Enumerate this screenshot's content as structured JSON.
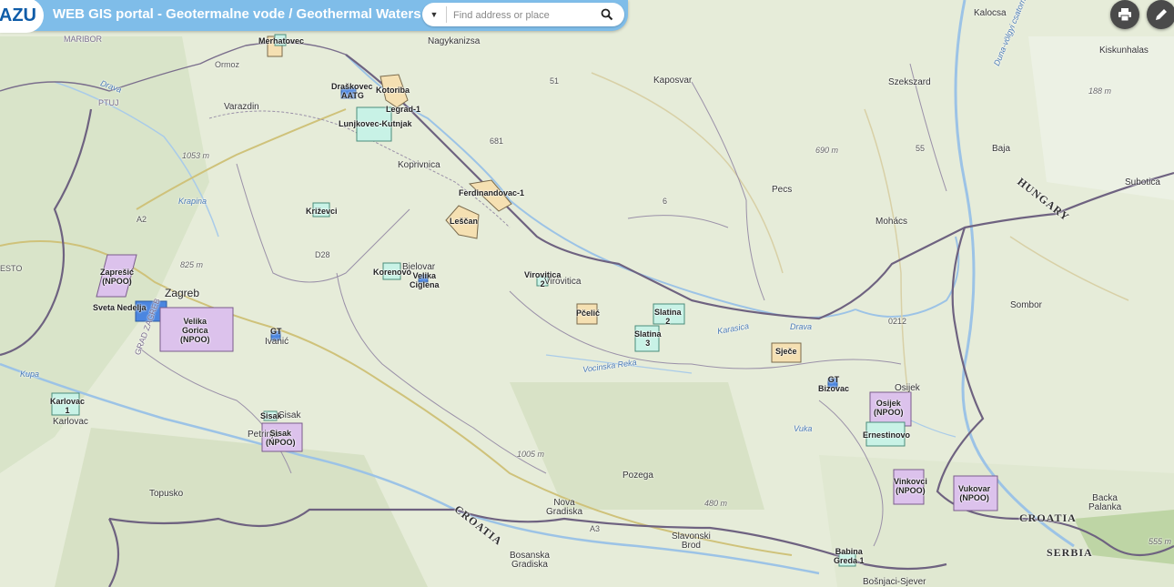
{
  "header": {
    "logo": "AZU",
    "title": "WEB GIS portal - Geotermalne vode / Geothermal Waters"
  },
  "search": {
    "placeholder": "Find address or place"
  },
  "toolbar": {
    "print_icon": "printer-icon",
    "edit_icon": "pencil-icon"
  },
  "map": {
    "cities": {
      "kalocsa": "Kalocsa",
      "kiskunhalas": "Kiskunhalas",
      "nagykanizsa": "Nagykanizsa",
      "kaposvar": "Kaposvar",
      "szekszard": "Szekszard",
      "ormoz": "Ormoz",
      "varazdin": "Varazdin",
      "baja": "Baja",
      "koprivnica": "Koprivnica",
      "pecs": "Pecs",
      "subotica": "Subotica",
      "mohacs": "Mohács",
      "zagreb": "Zagreb",
      "bjelovar": "Bjelovar",
      "virovitica": "Virovitica",
      "sombor": "Sombor",
      "ivanic": "Ivanić",
      "osijek": "Osijek",
      "karlovac": "Karlovac",
      "sisak": "Sisak",
      "petrinja": "Petrinja",
      "topusko": "Topusko",
      "pozega": "Pozega",
      "nova_gradiska": "Nova\nGradiska",
      "slavonski_brod": "Slavonski\nBrod",
      "bosanska_gradiska": "Bosanska\nGradiska",
      "backa_palanka": "Backa\nPalanka",
      "bosnjaci": "Bošnjaci-Sjever",
      "maribor": "MARIBOR",
      "pito": "PTUJ"
    },
    "sites": {
      "merhatovec": "Merhatovec",
      "draskovec": "Draškovec",
      "aatg": "AATG",
      "kotoriba": "Kotoriba",
      "legrad": "Legrad-1",
      "lunjkovec": "Lunjkovec-Kutnjak",
      "ferdinandovac": "Ferdinandovac-1",
      "krizevci": "Križevci",
      "lescan": "Leščan",
      "zapresic": "Zaprešić\n(NPOO)",
      "korenovo": "Korenovo",
      "velika_ciglena": "Velika\nCiglena",
      "virovitica2": "Virovitica\n2",
      "sveta_nedelja": "Sveta Nedelja",
      "velika_gorica": "Velika\nGorica\n(NPOO)",
      "pcelic": "Pčelić",
      "slatina2": "Slatina\n2",
      "slatina3": "Slatina\n3",
      "gt_ivanic": "GT",
      "sjece": "Sječe",
      "gt_bizovac": "GT\nBizovac",
      "osijek_npoo": "Osijek\n(NPOO)",
      "karlovac1": "Karlovac\n1",
      "sisak_npoo": "Sisak\n(NPOO)",
      "sisak_small": "Sisak",
      "ernestinovo": "Ernestinovo",
      "vinkovci": "Vinkovci\n(NPOO)",
      "vukovar": "Vukovar\n(NPOO)",
      "babina_greda": "Babina\nGreda 1"
    },
    "rivers": {
      "drava1": "Drava",
      "drava2": "Drava",
      "krapina": "Krapina",
      "karasica": "Karasica",
      "vocinska": "Vocinska Reka",
      "vuka": "Vuka",
      "duna": "Duna-völgyi csatorna",
      "kupa": "Kupa"
    },
    "elevations": {
      "e1053": "1053 m",
      "e825": "825 m",
      "e690": "690 m",
      "e188": "188 m",
      "e1005": "1005 m",
      "e480": "480 m",
      "e555": "555 m"
    },
    "countries": {
      "hungary": "HUNGARY",
      "croatia1": "CROATIA",
      "croatia2": "CROATIA",
      "serbia": "SERBIA",
      "slovenia_edge": "ESTO",
      "grad_zagreb": "GRAD ZAGREB"
    },
    "roads": {
      "r681": "681",
      "rD28": "D28",
      "rA3": "A3",
      "rA2": "A2",
      "rA3b": "A3",
      "r55": "55",
      "r51": "51",
      "r6": "6",
      "r0212": "0212"
    }
  },
  "colors": {
    "header_bg": "#7fbde9",
    "logo_text": "#0f5ca8",
    "npoo_fill": "#dcc2ec",
    "exploration_fill": "#c8f2e6",
    "concession_fill": "#f5e0b2",
    "gt_fill": "#4b86e0",
    "border": "#7a5c8c"
  }
}
